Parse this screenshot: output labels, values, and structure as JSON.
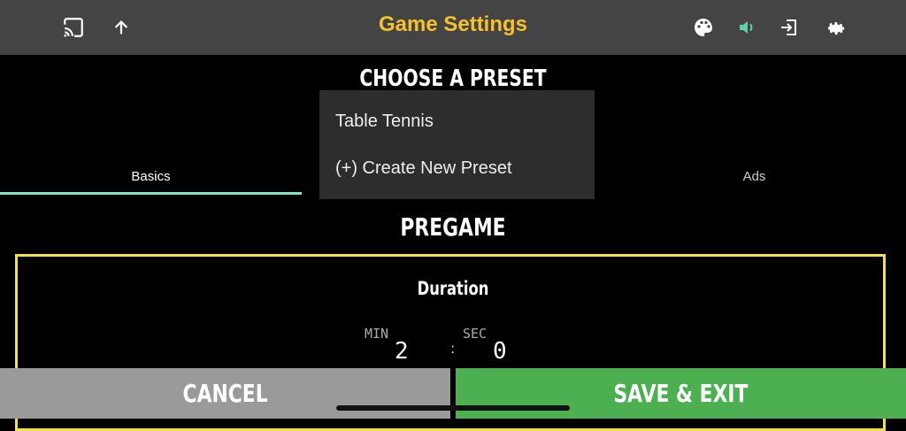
{
  "header": {
    "title": "Game Settings",
    "icons": [
      "cast-icon",
      "arrow-up-icon",
      "palette-icon",
      "volume-icon",
      "exit-icon",
      "gear-icon"
    ],
    "volume_color": "#5fd3a6",
    "title_color": "#f6c12c"
  },
  "preset": {
    "heading": "CHOOSE A PRESET",
    "dropdown": [
      "Table Tennis",
      "(+) Create New Preset"
    ]
  },
  "tabs": [
    {
      "label": "Basics",
      "active": true
    },
    {
      "label": "Ads",
      "active": false
    }
  ],
  "section": {
    "title": "PREGAME",
    "duration_label": "Duration",
    "min_label": "MIN",
    "sec_label": "SEC",
    "min_value": "2",
    "sec_value": "0",
    "separator": ":"
  },
  "footer": {
    "cancel": "CANCEL",
    "save": "SAVE & EXIT"
  }
}
